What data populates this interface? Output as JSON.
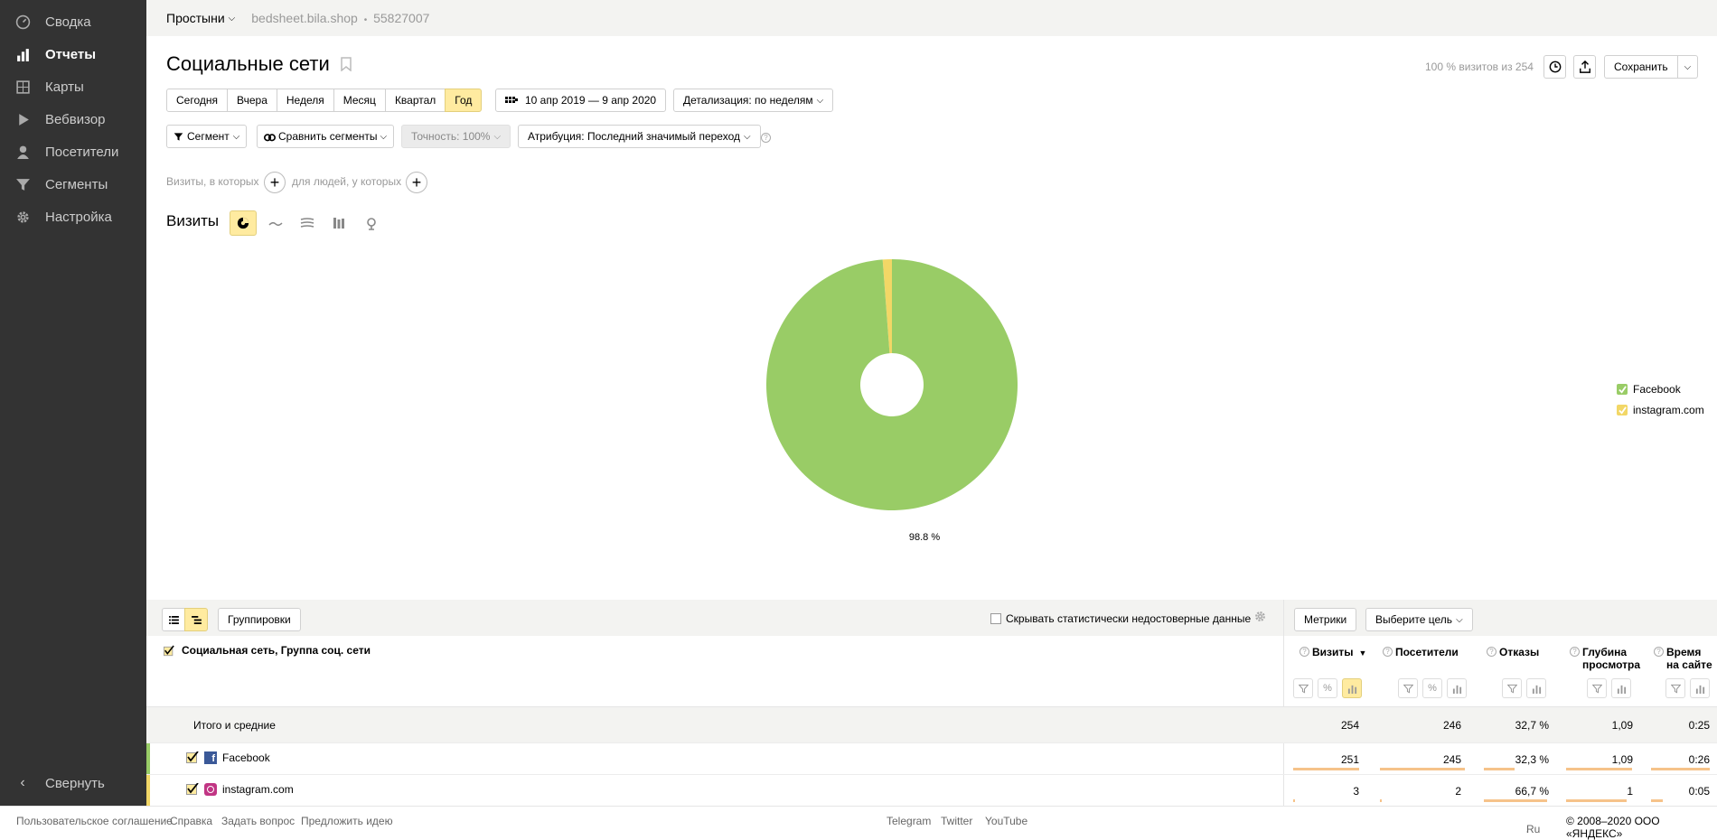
{
  "sidebar": {
    "items": [
      {
        "label": "Сводка",
        "icon": "gauge-icon"
      },
      {
        "label": "Отчеты",
        "icon": "bar-chart-icon"
      },
      {
        "label": "Карты",
        "icon": "map-icon"
      },
      {
        "label": "Вебвизор",
        "icon": "play-icon"
      },
      {
        "label": "Посетители",
        "icon": "person-icon"
      },
      {
        "label": "Сегменты",
        "icon": "filter-icon"
      },
      {
        "label": "Настройка",
        "icon": "gear-icon"
      }
    ],
    "collapse_label": "Свернуть"
  },
  "topbar": {
    "counter_name": "Простыни",
    "site": "bedsheet.bila.shop",
    "counter_id": "55827007"
  },
  "header": {
    "title": "Социальные сети",
    "visits_share": "100 % визитов из 254",
    "save_label": "Сохранить"
  },
  "periods": [
    "Сегодня",
    "Вчера",
    "Неделя",
    "Месяц",
    "Квартал",
    "Год"
  ],
  "selected_period": "Год",
  "date_range": "10 апр 2019 — 9 апр 2020",
  "detail": "Детализация: по неделям",
  "filters": {
    "segment": "Сегмент",
    "compare": "Сравнить сегменты",
    "accuracy": "Точность: 100%",
    "attribution": "Атрибуция: Последний значимый переход"
  },
  "segment_builder": {
    "visits_text": "Визиты, в которых",
    "people_text": "для людей, у которых"
  },
  "chart_section": {
    "label": "Визиты"
  },
  "chart_data": {
    "type": "pie",
    "categories": [
      "Facebook",
      "instagram.com"
    ],
    "values": [
      251,
      3
    ],
    "colors": [
      "#99cc66",
      "#f2d766"
    ],
    "slice_label": "98.8 %",
    "legend_position": "right"
  },
  "table_toolbar": {
    "groupings": "Группировки",
    "hide_unreliable": "Скрывать статистически недостоверные данные",
    "metrics": "Метрики",
    "goal": "Выберите цель"
  },
  "table": {
    "dimension_header": "Социальная сеть, Группа соц. сети",
    "columns": [
      {
        "label": "Визиты",
        "sub": "",
        "sorted": "▼"
      },
      {
        "label": "Посетители",
        "sub": ""
      },
      {
        "label": "Отказы",
        "sub": ""
      },
      {
        "label": "Глубина",
        "sub": "просмотра"
      },
      {
        "label": "Время",
        "sub": "на сайте"
      }
    ],
    "total": {
      "label": "Итого и средние",
      "values": [
        "254",
        "246",
        "32,7 %",
        "1,09",
        "0:25"
      ]
    },
    "rows": [
      {
        "label": "Facebook",
        "values": [
          "251",
          "245",
          "32,3 %",
          "1,09",
          "0:26"
        ],
        "color": "#99cc66",
        "bar_fractions": [
          0.99,
          0.99,
          0.48,
          1.0,
          1.0
        ]
      },
      {
        "label": "instagram.com",
        "values": [
          "3",
          "2",
          "66,7 %",
          "1",
          "0:05"
        ],
        "color": "#f2d766",
        "bar_fractions": [
          0.02,
          0.02,
          1.0,
          0.92,
          0.2
        ]
      }
    ]
  },
  "footer": {
    "agreement": "Пользовательское соглашение",
    "help": "Справка",
    "ask": "Задать вопрос",
    "idea": "Предложить идею",
    "telegram": "Telegram",
    "twitter": "Twitter",
    "youtube": "YouTube",
    "lang": "Ru",
    "copyright": "© 2008–2020 ООО «ЯНДЕКС»"
  }
}
